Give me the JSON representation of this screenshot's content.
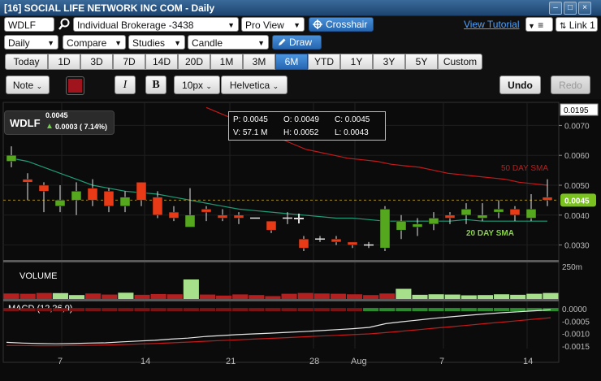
{
  "window": {
    "title": "[16] SOCIAL LIFE NETWORK INC COM - Daily"
  },
  "toolbar1": {
    "symbol": "WDLF",
    "account": "Individual Brokerage -3438",
    "view": "Pro View",
    "crosshair_label": "Crosshair",
    "tutorial_label": "View Tutorial",
    "link_label": "Link 1"
  },
  "toolbar2": {
    "interval": "Daily",
    "compare": "Compare",
    "studies": "Studies",
    "chart_type": "Candle",
    "draw_label": "Draw"
  },
  "ranges": [
    "Today",
    "1D",
    "3D",
    "7D",
    "14D",
    "20D",
    "1M",
    "3M",
    "6M",
    "YTD",
    "1Y",
    "3Y",
    "5Y",
    "Custom"
  ],
  "active_range": "6M",
  "drawtools": {
    "note": "Note",
    "italic": "I",
    "bold": "B",
    "size": "10px",
    "font": "Helvetica",
    "undo": "Undo",
    "redo": "Redo",
    "color": "#a0141e"
  },
  "symbol_box": {
    "symbol": "WDLF",
    "price": "0.0045",
    "change": "0.0003 ( 7.14%)"
  },
  "ohlc": {
    "p": "P: 0.0045",
    "o": "O: 0.0049",
    "c": "C: 0.0045",
    "v": "V: 57.1 M",
    "h": "H: 0.0052",
    "l": "L: 0.0043"
  },
  "colors": {
    "up": "#55a81e",
    "down": "#e83a16",
    "sma50": "#c41a1a",
    "sma20": "#1f9c77",
    "accent": "#2566b0"
  },
  "chart_data": {
    "type": "candlestick",
    "x_ticks": [
      "7",
      "14",
      "21",
      "28",
      "Aug",
      "7",
      "14"
    ],
    "y_ticks": [
      "0.0070",
      "0.0060",
      "0.0050",
      "0.0040",
      "0.0030"
    ],
    "ylim": [
      0.0025,
      0.0075
    ],
    "price_top_label": "0.0195",
    "last_price_label": "0.0045",
    "candles": [
      {
        "o": 0.0058,
        "c": 0.006,
        "h": 0.0063,
        "l": 0.0056
      },
      {
        "o": 0.0052,
        "c": 0.0051,
        "h": 0.0054,
        "l": 0.0045
      },
      {
        "o": 0.005,
        "c": 0.0048,
        "h": 0.0051,
        "l": 0.0041
      },
      {
        "o": 0.0043,
        "c": 0.0045,
        "h": 0.005,
        "l": 0.0041
      },
      {
        "o": 0.0045,
        "c": 0.0048,
        "h": 0.0051,
        "l": 0.004
      },
      {
        "o": 0.0049,
        "c": 0.0045,
        "h": 0.0052,
        "l": 0.0043
      },
      {
        "o": 0.0048,
        "c": 0.0043,
        "h": 0.0049,
        "l": 0.0041
      },
      {
        "o": 0.0043,
        "c": 0.0046,
        "h": 0.0048,
        "l": 0.0041
      },
      {
        "o": 0.0051,
        "c": 0.0045,
        "h": 0.0051,
        "l": 0.0043
      },
      {
        "o": 0.0046,
        "c": 0.004,
        "h": 0.0048,
        "l": 0.0039
      },
      {
        "o": 0.0041,
        "c": 0.0039,
        "h": 0.0043,
        "l": 0.0038
      },
      {
        "o": 0.0036,
        "c": 0.004,
        "h": 0.0049,
        "l": 0.0036
      },
      {
        "o": 0.0042,
        "c": 0.0041,
        "h": 0.0043,
        "l": 0.0038
      },
      {
        "o": 0.004,
        "c": 0.0039,
        "h": 0.0042,
        "l": 0.0038
      },
      {
        "o": 0.004,
        "c": 0.0039,
        "h": 0.0041,
        "l": 0.0037
      },
      {
        "o": 0.0039,
        "c": 0.0039,
        "h": 0.0039,
        "l": 0.0039
      },
      {
        "o": 0.0038,
        "c": 0.0035,
        "h": 0.0038,
        "l": 0.0034
      },
      {
        "o": 0.0039,
        "c": 0.0039,
        "h": 0.0041,
        "l": 0.0037
      },
      {
        "o": 0.0032,
        "c": 0.0029,
        "h": 0.0033,
        "l": 0.0028
      },
      {
        "o": 0.0032,
        "c": 0.0032,
        "h": 0.0033,
        "l": 0.0031
      },
      {
        "o": 0.0032,
        "c": 0.0031,
        "h": 0.0033,
        "l": 0.003
      },
      {
        "o": 0.0031,
        "c": 0.003,
        "h": 0.0031,
        "l": 0.0029
      },
      {
        "o": 0.003,
        "c": 0.003,
        "h": 0.0031,
        "l": 0.0029
      },
      {
        "o": 0.0029,
        "c": 0.0042,
        "h": 0.0043,
        "l": 0.0028
      },
      {
        "o": 0.0035,
        "c": 0.0038,
        "h": 0.004,
        "l": 0.0032
      },
      {
        "o": 0.0036,
        "c": 0.0037,
        "h": 0.0039,
        "l": 0.0033
      },
      {
        "o": 0.0037,
        "c": 0.0039,
        "h": 0.0041,
        "l": 0.0035
      },
      {
        "o": 0.004,
        "c": 0.0039,
        "h": 0.0041,
        "l": 0.0037
      },
      {
        "o": 0.004,
        "c": 0.0042,
        "h": 0.0044,
        "l": 0.0037
      },
      {
        "o": 0.0039,
        "c": 0.004,
        "h": 0.0044,
        "l": 0.0038
      },
      {
        "o": 0.0041,
        "c": 0.0042,
        "h": 0.0045,
        "l": 0.0039
      },
      {
        "o": 0.0042,
        "c": 0.004,
        "h": 0.0043,
        "l": 0.0038
      },
      {
        "o": 0.0039,
        "c": 0.0042,
        "h": 0.0047,
        "l": 0.0038
      },
      {
        "o": 0.0046,
        "c": 0.0045,
        "h": 0.0052,
        "l": 0.0043
      }
    ],
    "sma50": {
      "name": "50 DAY SMA",
      "values": [
        0.0076,
        0.0074,
        0.0072,
        0.007,
        0.0068,
        0.0066,
        0.0064,
        0.0062,
        0.0061,
        0.006,
        0.0059,
        0.00585,
        0.0058,
        0.0057,
        0.00565,
        0.0056,
        0.0055,
        0.0054,
        0.00535,
        0.0053,
        0.00525,
        0.0052,
        0.0051,
        0.00505,
        0.005
      ]
    },
    "sma20": {
      "name": "20 DAY SMA",
      "values": [
        0.0059,
        0.0058,
        0.0056,
        0.0054,
        0.0052,
        0.005,
        0.0049,
        0.0048,
        0.00475,
        0.0047,
        0.0046,
        0.0045,
        0.0044,
        0.0043,
        0.0042,
        0.00415,
        0.0041,
        0.00405,
        0.004,
        0.00395,
        0.0039,
        0.0039,
        0.00385,
        0.0038,
        0.0038,
        0.0038,
        0.0038,
        0.0038,
        0.00385,
        0.0038,
        0.0038,
        0.0038,
        0.0038,
        0.0038
      ]
    },
    "volume": {
      "label": "VOLUME",
      "ylim": [
        0,
        250
      ],
      "y_tick_label": "250m",
      "values": [
        42,
        40,
        46,
        45,
        30,
        42,
        34,
        48,
        32,
        38,
        36,
        150,
        34,
        26,
        35,
        30,
        22,
        40,
        46,
        42,
        40,
        36,
        30,
        42,
        78,
        32,
        36,
        34,
        28,
        30,
        36,
        32,
        40,
        46
      ],
      "up": [
        false,
        false,
        false,
        true,
        true,
        false,
        false,
        true,
        false,
        false,
        false,
        true,
        false,
        false,
        false,
        false,
        false,
        false,
        false,
        false,
        false,
        false,
        false,
        false,
        true,
        true,
        true,
        true,
        true,
        true,
        true,
        true,
        true,
        true
      ]
    },
    "macd": {
      "label": "MACD (12,26,9)",
      "y_ticks": [
        "0.0000",
        "-0.0005",
        "-0.0010",
        "-0.0015"
      ],
      "ylim": [
        -0.0016,
        0.0002
      ],
      "macd": [
        -0.00135,
        -0.00138,
        -0.0014,
        -0.00141,
        -0.0014,
        -0.00138,
        -0.00137,
        -0.00133,
        -0.0013,
        -0.00127,
        -0.00122,
        -0.00118,
        -0.00112,
        -0.00108,
        -0.00104,
        -0.00101,
        -0.00098,
        -0.00095,
        -0.00092,
        -0.00088,
        -0.00084,
        -0.0008,
        -0.00075,
        -0.0006,
        -0.00052,
        -0.00045,
        -0.00038,
        -0.00032,
        -0.00026,
        -0.00021,
        -0.00016,
        -0.00012,
        -8e-05,
        -4e-05
      ],
      "signal": [
        -0.00148,
        -0.00148,
        -0.00149,
        -0.00149,
        -0.00148,
        -0.00147,
        -0.00146,
        -0.00144,
        -0.00142,
        -0.0014,
        -0.00137,
        -0.00134,
        -0.00131,
        -0.00128,
        -0.00125,
        -0.00122,
        -0.00119,
        -0.00116,
        -0.00113,
        -0.0011,
        -0.00107,
        -0.00104,
        -0.00101,
        -0.00096,
        -0.0009,
        -0.00084,
        -0.00078,
        -0.00072,
        -0.00066,
        -0.0006,
        -0.00054,
        -0.00048,
        -0.00042,
        -0.00036
      ],
      "histogram_up": [
        false,
        false,
        false,
        false,
        false,
        false,
        false,
        false,
        false,
        false,
        false,
        false,
        false,
        false,
        false,
        false,
        false,
        false,
        false,
        false,
        false,
        false,
        true,
        true,
        true,
        true,
        true,
        true,
        true,
        true,
        true,
        true,
        true,
        true
      ]
    }
  }
}
